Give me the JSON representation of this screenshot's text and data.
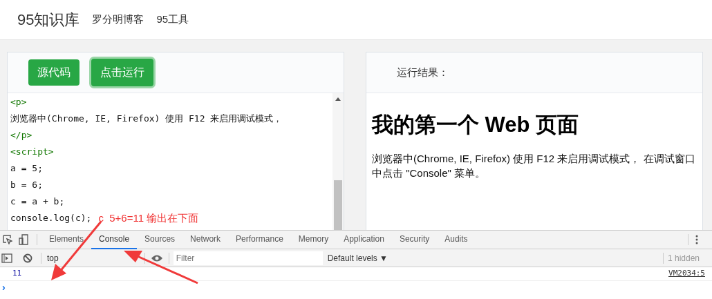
{
  "header": {
    "logo": "95知识库",
    "links": [
      "罗分明博客",
      "95工具"
    ]
  },
  "editor": {
    "buttons": [
      {
        "label": "源代码",
        "focused": false
      },
      {
        "label": "点击运行",
        "focused": true
      }
    ],
    "lines": [
      {
        "kind": "tag",
        "text": "<p>"
      },
      {
        "kind": "text",
        "text": "浏览器中(Chrome, IE, Firefox) 使用 F12 来启用调试模式，"
      },
      {
        "kind": "tag",
        "text": "</p>"
      },
      {
        "kind": "tag",
        "text": "<script>"
      },
      {
        "kind": "text",
        "text": "a = 5;"
      },
      {
        "kind": "text",
        "text": "b = 6;"
      },
      {
        "kind": "text",
        "text": "c = a + b;"
      },
      {
        "kind": "text",
        "text": "console.log(c);",
        "note": "c  5+6=11 输出在下面"
      }
    ]
  },
  "result": {
    "title": "运行结果：",
    "heading": "我的第一个 Web 页面",
    "paragraph": "浏览器中(Chrome, IE, Firefox) 使用 F12 来启用调试模式， 在调试窗口中点击 \"Console\" 菜单。"
  },
  "devtools": {
    "tabs": [
      {
        "label": "Elements",
        "selected": false
      },
      {
        "label": "Console",
        "selected": true
      },
      {
        "label": "Sources",
        "selected": false
      },
      {
        "label": "Network",
        "selected": false
      },
      {
        "label": "Performance",
        "selected": false
      },
      {
        "label": "Memory",
        "selected": false
      },
      {
        "label": "Application",
        "selected": false
      },
      {
        "label": "Security",
        "selected": false
      },
      {
        "label": "Audits",
        "selected": false
      }
    ],
    "context": "top",
    "filter": {
      "placeholder": "Filter"
    },
    "levels": "Default levels ▼",
    "hidden": "1 hidden",
    "messages": [
      {
        "value": "11",
        "source": "VM2034:5"
      }
    ],
    "prompt": "›"
  }
}
